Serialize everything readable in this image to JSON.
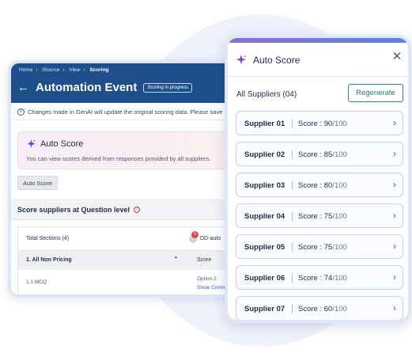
{
  "back_window": {
    "breadcrumbs": [
      "Home",
      "iSource",
      "View",
      "Scoring"
    ],
    "title": "Automation Event",
    "status": "Scoring in progress",
    "info_text": "Changes made in GenAI will update the original scoring data. Please save",
    "auto_card": {
      "title": "Auto Score",
      "subtitle": "You can view scores derived from responses provided by all suppliers."
    },
    "auto_score_button": "Auto Score",
    "section_title": "Score suppliers at Question level",
    "table": {
      "header_sections": "Total Sections (4)",
      "header_supplier": "DD-auto",
      "badge_count": "5",
      "row_section": "1. All Non Pricing",
      "row_score_label": "Score",
      "row_question": "1.1 MCQ",
      "row_answer": "Option 2",
      "row_link": "Show Comme"
    }
  },
  "panel": {
    "title": "Auto Score",
    "suppliers_label": "All Suppliers (04)",
    "regenerate_label": "Regenerate",
    "score_label": "Score :",
    "suppliers": [
      {
        "name": "Supplier 01",
        "score": "90",
        "max": "/100"
      },
      {
        "name": "Supplier 02",
        "score": "85",
        "max": "/100"
      },
      {
        "name": "Supplier 03",
        "score": "80",
        "max": "/100"
      },
      {
        "name": "Supplier 04",
        "score": "75",
        "max": "/100"
      },
      {
        "name": "Supplier 05",
        "score": "75",
        "max": "/100"
      },
      {
        "name": "Supplier 06",
        "score": "74",
        "max": "/100"
      },
      {
        "name": "Supplier 07",
        "score": "60",
        "max": "/100"
      }
    ]
  },
  "colors": {
    "header_blue": "#1e4f8c",
    "accent_purple": "#7b3fe4",
    "regenerate_green": "#2e7d50"
  },
  "icons": [
    "back-arrow-icon",
    "info-icon",
    "sparkle-icon",
    "close-icon",
    "chevron-right-icon",
    "chevron-up-icon"
  ]
}
